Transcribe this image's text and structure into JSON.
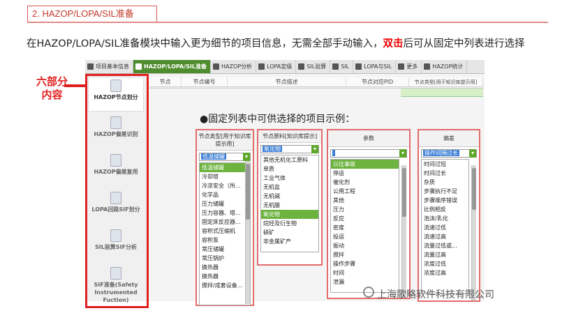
{
  "section_title": "2. HAZOP/LOPA/SIL准备",
  "headline": {
    "pre": "在HAZOP/LOPA/SIL准备模块中输入更为细节的项目信息，无需全部手动输入，",
    "highlight": "双击",
    "post": "后可从固定中列表进行选择"
  },
  "callout": {
    "line1": "六部分",
    "line2": "内容"
  },
  "tabs": [
    {
      "label": "项目基本信息",
      "icon": "info-icon"
    },
    {
      "label": "HAZOP/LOPA/SIL准备",
      "icon": "folder-icon"
    },
    {
      "label": "HAZOP分析",
      "icon": "analysis-icon"
    },
    {
      "label": "LOPA定级",
      "icon": "layers-icon"
    },
    {
      "label": "SIL验算",
      "icon": "calc-icon"
    },
    {
      "label": "SIL",
      "icon": "sil-icon"
    },
    {
      "label": "LOPA与SIL",
      "icon": "link-icon"
    },
    {
      "label": "更多",
      "icon": "more-icon"
    },
    {
      "label": "HAZOP统计",
      "icon": "stats-icon"
    }
  ],
  "sidebar": [
    {
      "label": "HAZOP节点划分"
    },
    {
      "label": "HAZOP偏差识别"
    },
    {
      "label": "HAZOP偏差复用"
    },
    {
      "label": "LOPA回路SIF划分"
    },
    {
      "label": "SIL验算SIF分析"
    },
    {
      "label": "SIF准备(Safety Instrumented Fuction)"
    }
  ],
  "grid_columns": [
    "节点",
    "节点编号",
    "节点描述",
    "节点对应PID",
    "节点类型[用于知识库提示用]"
  ],
  "subhead": "●固定列表中可供选择的项目示例：",
  "lists": [
    {
      "header": "节点类型[用于知识库提示用]",
      "selected": "低温储罐",
      "items": [
        "低温储罐",
        "冷却塔",
        "冷凉安全（所...",
        "化学品",
        "压力储罐",
        "压力容器、塔...",
        "固定床反应器...",
        "容积式压缩机",
        "容积泵",
        "常压储罐",
        "常压锅炉",
        "换热器",
        "换热器",
        "搅拌/成套设备..."
      ],
      "active": 0
    },
    {
      "header": "节点原料[知识库提示]",
      "selected": "氧化物",
      "items": [
        "其他无机化工原料",
        "单质",
        "工业气体",
        "无机盐",
        "无机碱",
        "无机酸",
        "氧化物",
        "烷烃及衍生物",
        "硝矿",
        "非金属矿产"
      ],
      "active": 6
    },
    {
      "header": "参数",
      "selected": "",
      "items": [
        "以往事故",
        "停运",
        "催化剂",
        "公用工程",
        "其他",
        "压力",
        "反应",
        "密度",
        "投运",
        "振动",
        "搅拌",
        "操作步骤",
        "时间",
        "泄漏"
      ],
      "active": 0
    },
    {
      "header": "偏差",
      "selected": "操作间隔过长",
      "items": [
        "时间过短",
        "时间过长",
        "杂质",
        "步骤执行不足",
        "步骤顺序错误",
        "比例相反",
        "泡沫/乳化",
        "流速过低",
        "流速过高",
        "流量过低或...",
        "流量过高",
        "浓度过低",
        "浓度过高"
      ],
      "active": -1
    }
  ],
  "watermark": "上海歌略软件科技有限公司",
  "colors": {
    "accent_red": "#e02020",
    "tab_green": "#4f8c2e",
    "highlight_green": "#6db33f"
  }
}
